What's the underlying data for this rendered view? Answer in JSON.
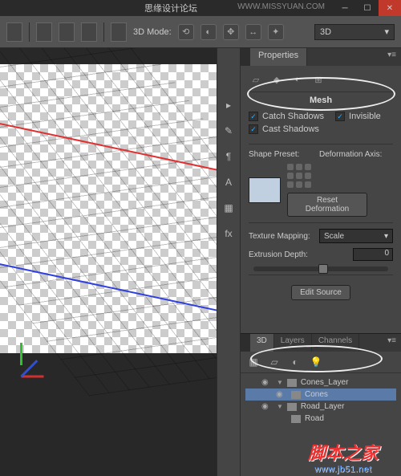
{
  "title": "思缘设计论坛",
  "watermark_url_top": "WWW.MISSYUAN.COM",
  "optionsbar": {
    "mode_label": "3D Mode:",
    "render_dropdown": "3D"
  },
  "properties": {
    "tab": "Properties",
    "section": "Mesh",
    "catch_shadows": "Catch Shadows",
    "invisible": "Invisible",
    "cast_shadows": "Cast Shadows",
    "shape_preset": "Shape Preset:",
    "deform_axis": "Deformation Axis:",
    "reset_deform": "Reset Deformation",
    "tex_mapping": "Texture Mapping:",
    "tex_value": "Scale",
    "extrusion": "Extrusion Depth:",
    "extrusion_value": "0",
    "edit_source": "Edit Source"
  },
  "panel3d": {
    "tabs": [
      "3D",
      "Layers",
      "Channels"
    ],
    "tree": {
      "cones_layer": "Cones_Layer",
      "cones": "Cones",
      "road_layer": "Road_Layer",
      "road": "Road"
    }
  },
  "footer": {
    "brand": "脚本之家",
    "url": "www.jb51.net"
  }
}
